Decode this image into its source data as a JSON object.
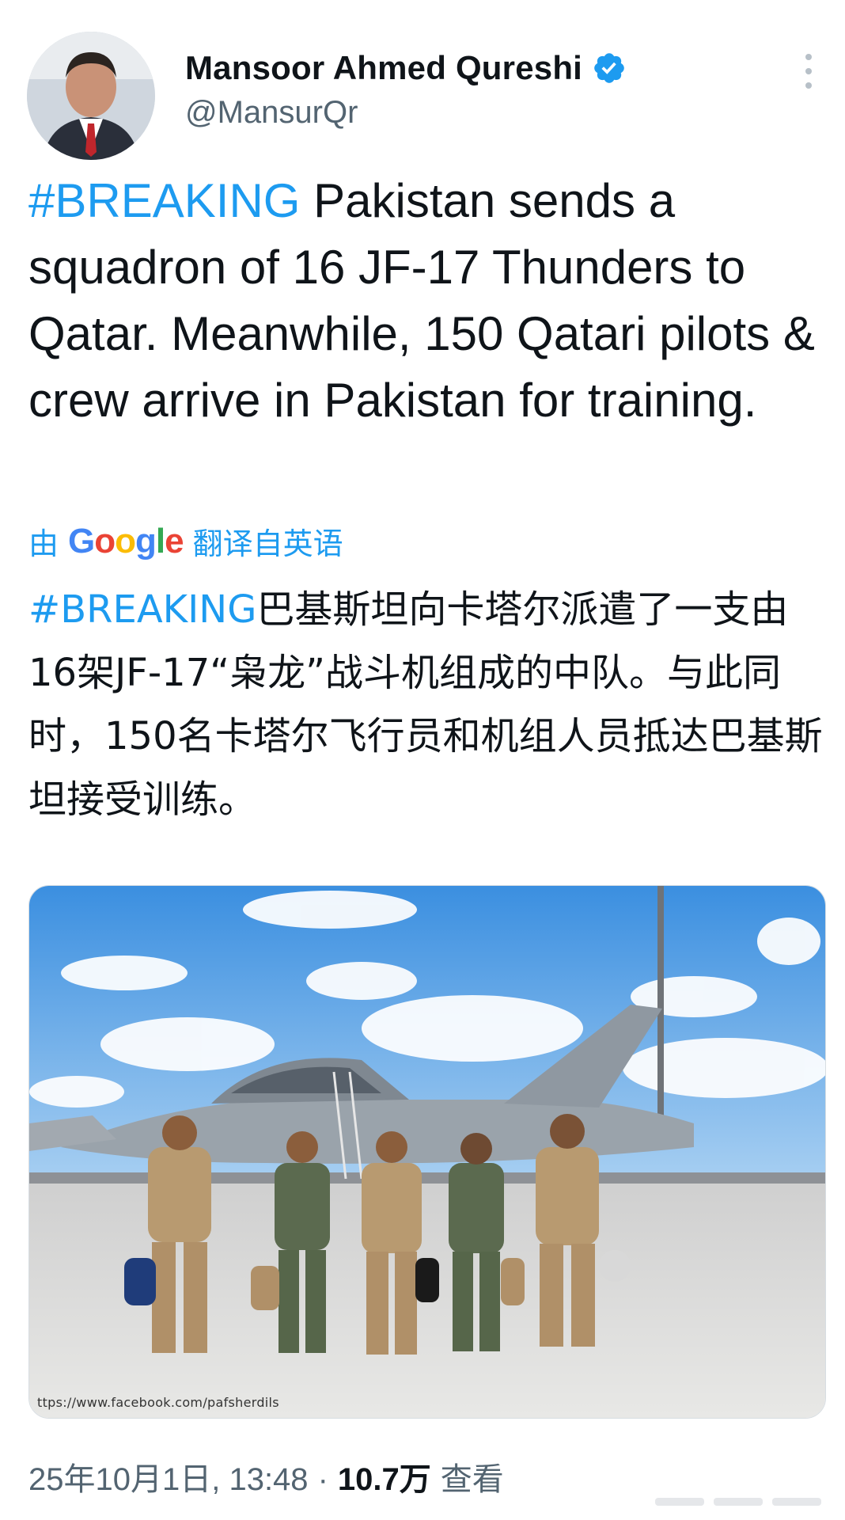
{
  "author": {
    "display_name": "Mansoor Ahmed Qureshi",
    "handle": "@MansurQr",
    "verified": true
  },
  "tweet": {
    "hashtag": "#BREAKING",
    "text": " Pakistan sends a squadron of 16 JF-17 Thunders to Qatar. Meanwhile, 150 Qatari pilots & crew arrive in Pakistan for training."
  },
  "translation": {
    "prefix": "由",
    "provider": "Google",
    "suffix": "翻译自英语",
    "hashtag": "#BREAKING",
    "text": "巴基斯坦向卡塔尔派遣了一支由16架JF-17“枭龙”战斗机组成的中队。与此同时，150名卡塔尔飞行员和机组人员抵达巴基斯坦接受训练。"
  },
  "media": {
    "credit": "ttps://www.facebook.com/pafsherdils"
  },
  "meta": {
    "timestamp": "25年10月1日, 13:48",
    "separator": "·",
    "views_count": "10.7万",
    "views_label": "查看"
  },
  "colors": {
    "link": "#1d9bf0",
    "verified": "#1d9bf0",
    "secondary_text": "#536471"
  },
  "icons": [
    "verified-badge-icon",
    "more-options-icon",
    "google-logo"
  ]
}
